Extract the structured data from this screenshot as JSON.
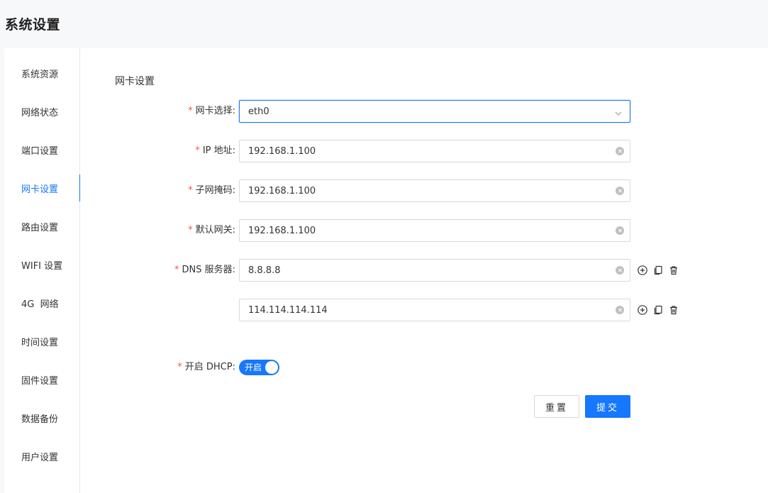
{
  "page": {
    "title": "系统设置"
  },
  "sidebar": {
    "items": [
      {
        "label": "系统资源"
      },
      {
        "label": "网络状态"
      },
      {
        "label": "端口设置"
      },
      {
        "label": "网卡设置"
      },
      {
        "label": "路由设置"
      },
      {
        "label": "WIFI 设置"
      },
      {
        "label": "4G  网络"
      },
      {
        "label": "时间设置"
      },
      {
        "label": "固件设置"
      },
      {
        "label": "数据备份"
      },
      {
        "label": "用户设置"
      }
    ],
    "active_index": 3
  },
  "form": {
    "section_title": "网卡设置",
    "required_mark": "*",
    "nic": {
      "label": "网卡选择:",
      "value": "eth0"
    },
    "ip": {
      "label": "IP 地址:",
      "value": "192.168.1.100"
    },
    "mask": {
      "label": "子网掩码:",
      "value": "192.168.1.100"
    },
    "gateway": {
      "label": "默认网关:",
      "value": "192.168.1.100"
    },
    "dns": {
      "label": "DNS 服务器:",
      "servers": [
        {
          "value": "8.8.8.8"
        },
        {
          "value": "114.114.114.114"
        }
      ]
    },
    "dhcp": {
      "label": "开启 DHCP:",
      "switch_text": "开启",
      "enabled": true
    },
    "reset_label": "重置",
    "submit_label": "提交"
  },
  "colors": {
    "accent": "#1677ff",
    "required": "#ff4d4f",
    "border": "#d9d9d9"
  },
  "icons": {
    "clear": "clear-circle-icon",
    "dropdown": "chevron-down-icon",
    "add": "plus-circle-icon",
    "copy": "copy-icon",
    "delete": "trash-icon"
  }
}
